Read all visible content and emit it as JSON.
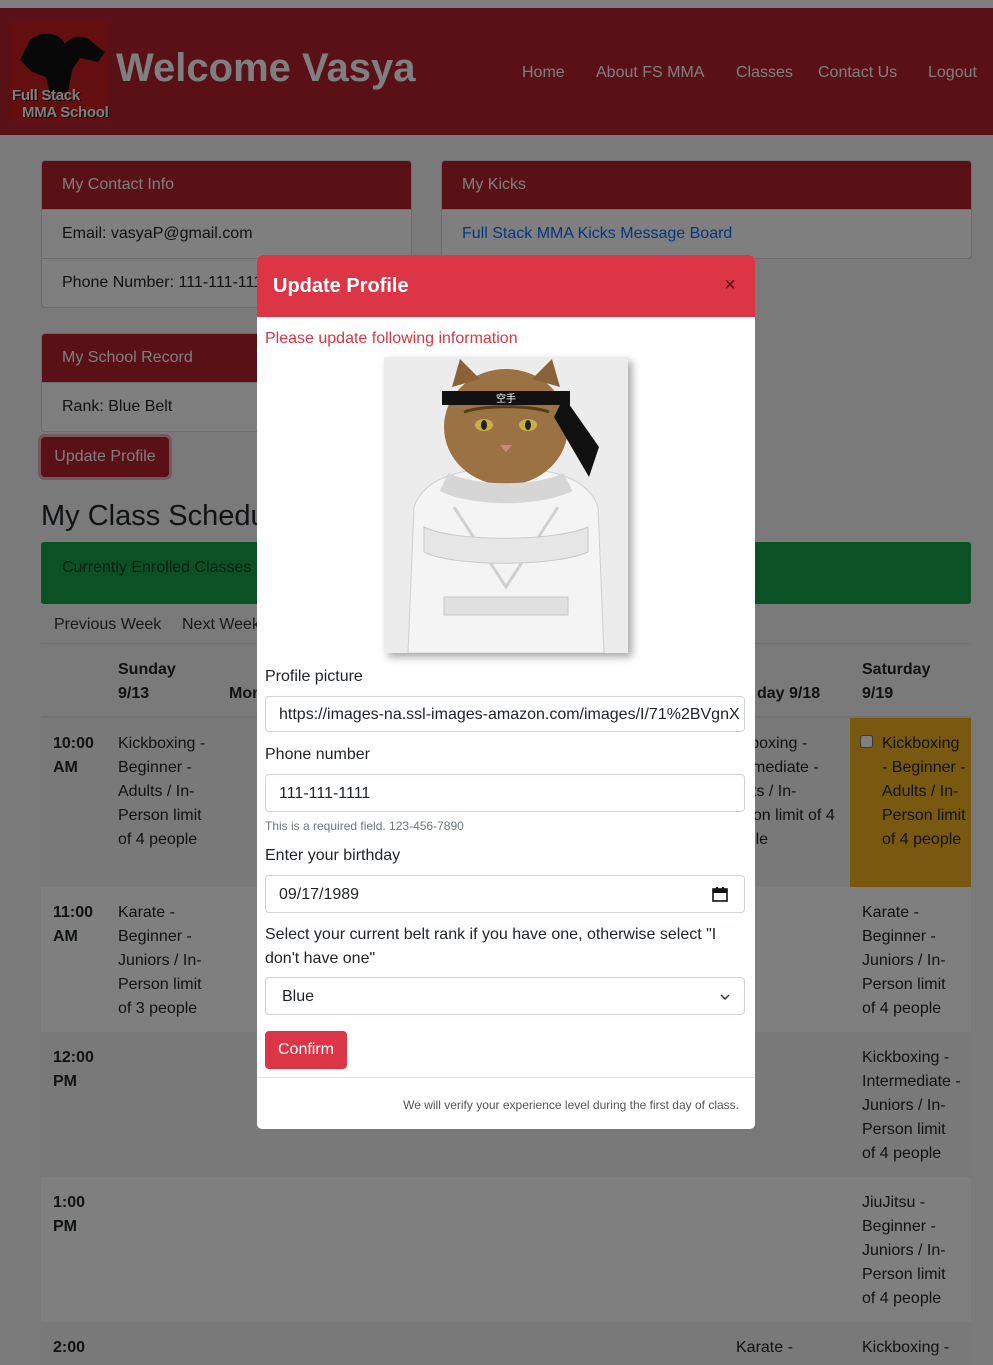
{
  "nav": {
    "brand": "Welcome Vasya",
    "logo_line1": "Full Stack",
    "logo_line2": "MMA School",
    "links": [
      "Home",
      "About FS MMA",
      "Classes",
      "Contact Us",
      "Logout"
    ]
  },
  "contact": {
    "title": "My Contact Info",
    "email": "Email: vasyaP@gmail.com",
    "phone": "Phone Number: 111-111-1111"
  },
  "kicks": {
    "title": "My Kicks",
    "link": "Full Stack MMA Kicks Message Board"
  },
  "record": {
    "title": "My School Record",
    "rank": "Rank: Blue Belt"
  },
  "update_button": "Update Profile",
  "schedule": {
    "title": "My Class Schedule",
    "enrolled_label": "Currently Enrolled Classes",
    "prev_week": "Previous Week",
    "next_week": "Next Week",
    "days": [
      {
        "name": "Sunday",
        "date": "9/13"
      },
      {
        "name": "Mon",
        "date": ""
      },
      {
        "name": "day 9/18",
        "date": ""
      },
      {
        "name": "Saturday",
        "date": "9/19"
      }
    ],
    "times": [
      "10:00 AM",
      "11:00 AM",
      "12:00 PM",
      "1:00 PM",
      "2:00"
    ],
    "sunday": [
      "Kickboxing - Beginner - Adults / In-Person limit of 4 people",
      "Karate - Beginner - Juniors / In-Person limit of 3 people"
    ],
    "friday_10": "Kickboxing - Intermediate - Adults / In-Person limit of 4 people",
    "friday_2": "Karate -",
    "saturday": [
      "Kickboxing - Beginner - Adults / In-Person limit of 4 people",
      "Karate - Beginner - Juniors / In-Person limit of 4 people",
      "Kickboxing - Intermediate - Juniors / In-Person limit of 4 people",
      "JiuJitsu - Beginner - Juniors / In-Person limit of 4 people",
      "Kickboxing -"
    ]
  },
  "modal": {
    "title": "Update Profile",
    "close": "×",
    "note": "Please update following information",
    "picture_label": "Profile picture",
    "picture_value": "https://images-na.ssl-images-amazon.com/images/I/71%2BVgnX",
    "phone_label": "Phone number",
    "phone_value": "111-111-1111",
    "phone_hint": "This is a required field. 123-456-7890",
    "birthday_label": "Enter your birthday",
    "birthday_value": "09/17/1989",
    "belt_label": "Select your current belt rank if you have one, otherwise select \"I don't have one\"",
    "belt_value": "Blue",
    "confirm": "Confirm",
    "footer": "We will verify your experience level during the first day of class.",
    "headband_text": "空手"
  },
  "colors": {
    "nav": "#b3212d",
    "modal_header": "#dc3545",
    "enrolled": "#16a34a",
    "highlight": "#f2b01e"
  }
}
